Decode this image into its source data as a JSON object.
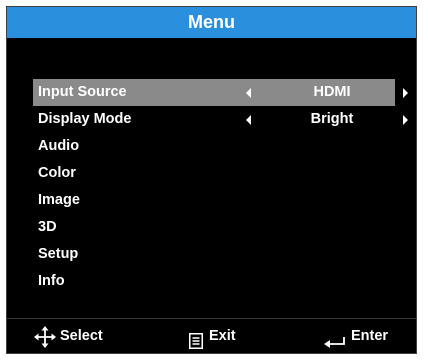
{
  "menu": {
    "title": "Menu",
    "items": [
      {
        "label": "Input Source",
        "value": "HDMI",
        "selected": true
      },
      {
        "label": "Display Mode",
        "value": "Bright"
      },
      {
        "label": "Audio"
      },
      {
        "label": "Color"
      },
      {
        "label": "Image"
      },
      {
        "label": "3D"
      },
      {
        "label": "Setup"
      },
      {
        "label": "Info"
      }
    ]
  },
  "footer": {
    "select_label": "Select",
    "exit_label": "Exit",
    "enter_label": "Enter",
    "select_icon": "four-way-arrows-icon",
    "exit_icon": "menu-icon",
    "enter_icon": "enter-return-icon"
  },
  "colors": {
    "title_bar": "#2a8fdc",
    "background": "#000000",
    "selected_row": "#8a8a8a",
    "text": "#ffffff"
  }
}
